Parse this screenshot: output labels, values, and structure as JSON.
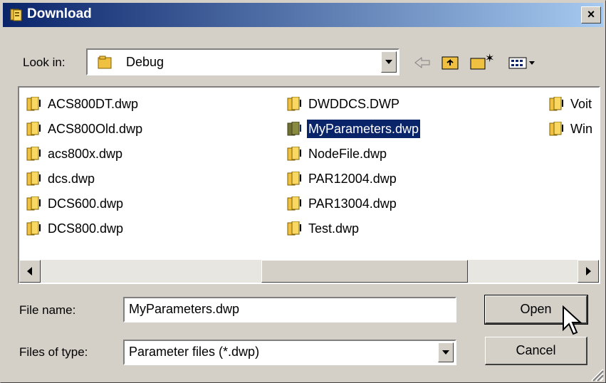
{
  "window": {
    "title": "Download"
  },
  "look_in": {
    "label": "Look in:",
    "value": "Debug"
  },
  "toolbar": {
    "icons": [
      "back-arrow-icon",
      "up-folder-icon",
      "new-folder-icon",
      "view-menu-icon"
    ]
  },
  "files": {
    "col1": [
      "ACS800DT.dwp",
      "ACS800Old.dwp",
      "acs800x.dwp",
      "dcs.dwp",
      "DCS600.dwp",
      "DCS800.dwp"
    ],
    "col2": [
      "DWDDCS.DWP",
      "MyParameters.dwp",
      "NodeFile.dwp",
      "PAR12004.dwp",
      "PAR13004.dwp",
      "Test.dwp"
    ],
    "col3": [
      "Voit",
      "Win"
    ],
    "selected": "MyParameters.dwp"
  },
  "file_name": {
    "label": "File name:",
    "value": "MyParameters.dwp"
  },
  "file_type": {
    "label": "Files of type:",
    "value": "Parameter files (*.dwp)"
  },
  "buttons": {
    "open": "Open",
    "cancel": "Cancel"
  },
  "close_glyph": "×"
}
